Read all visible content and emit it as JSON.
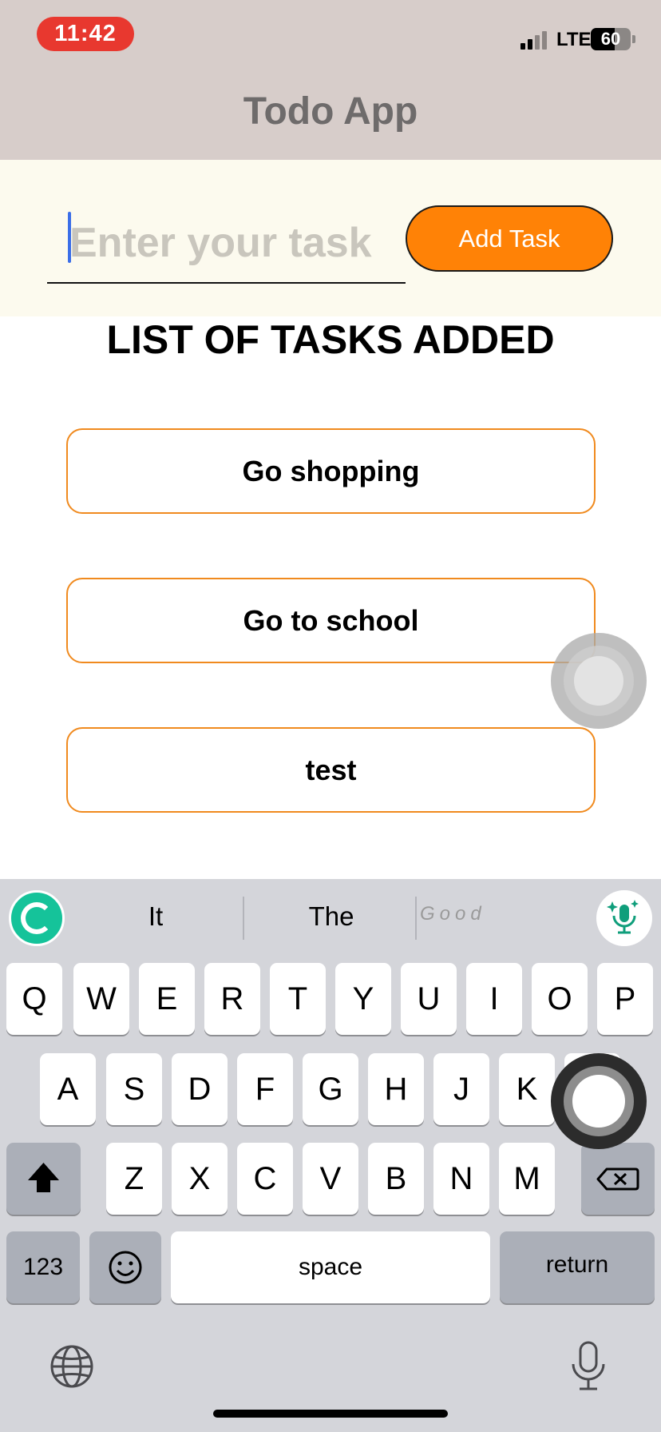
{
  "status_bar": {
    "time": "11:42",
    "network": "LTE",
    "battery": "60",
    "battery_level": 0.6
  },
  "header": {
    "title": "Todo App"
  },
  "task_form": {
    "input_placeholder": "Enter your task",
    "add_button_label": "Add Task",
    "accent_color": "#ff8206"
  },
  "list": {
    "heading": "LIST OF TASKS ADDED",
    "items": [
      "Go shopping",
      "Go to school",
      "test",
      ""
    ]
  },
  "keyboard": {
    "suggestions": [
      "It",
      "The",
      "Good"
    ],
    "rows": [
      [
        "Q",
        "W",
        "E",
        "R",
        "T",
        "Y",
        "U",
        "I",
        "O",
        "P"
      ],
      [
        "A",
        "S",
        "D",
        "F",
        "G",
        "H",
        "J",
        "K",
        "L"
      ],
      [
        "Z",
        "X",
        "C",
        "V",
        "B",
        "N",
        "M"
      ]
    ],
    "numbers_key": "123",
    "space_key": "space",
    "return_key": "return",
    "icons": [
      "grammarly-icon",
      "mic-sparkle-icon",
      "shift-icon",
      "backspace-icon",
      "emoji-icon",
      "globe-icon",
      "dictation-icon"
    ]
  }
}
